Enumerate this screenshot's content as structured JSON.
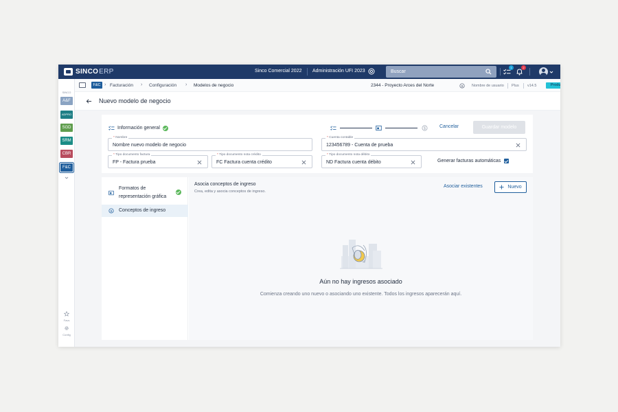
{
  "topbar": {
    "brand_bold": "SINCO",
    "brand_light": "ERP",
    "company": "Sinco Comercial 2022",
    "admin": "Administración UFI 2023",
    "search_placeholder": "Buscar",
    "tasks_badge": "1",
    "notifications_badge": "2"
  },
  "rail": {
    "title": "SINCO",
    "modules": [
      {
        "label": "A&F",
        "color": "#8aa3c2"
      },
      {
        "label": "ADPRO",
        "color": "#1f7f86"
      },
      {
        "label": "SGD",
        "color": "#5f9d4d"
      },
      {
        "label": "SRM",
        "color": "#1b8c86"
      },
      {
        "label": "CBR",
        "color": "#b84c5e"
      },
      {
        "label": "F&C",
        "color": "#1f5e9c"
      }
    ],
    "favorites_label": "Favs",
    "config_label": "Config"
  },
  "breadcrumb": {
    "module_chip": "F&C",
    "items": [
      "Facturación",
      "Configuración",
      "Modelos de negocio"
    ],
    "project": "2344 - Proyecto Arces del Norte",
    "username": "Nombre de usuario",
    "plan": "Plus",
    "version": "v14.5",
    "environment": "Producción"
  },
  "page": {
    "title": "Nuevo modelo de negocio"
  },
  "general_info": {
    "section_label": "Información general",
    "cancel_label": "Cancelar",
    "save_label": "Guardar modelo",
    "fields": {
      "name": {
        "label": "Nombre",
        "value": "Nombre nuevo modelo de negocio"
      },
      "account": {
        "label": "Cuenta contable",
        "value": "123456789 - Cuenta de prueba"
      },
      "invoice_doc": {
        "label": "Tipo documento factura",
        "value": "FP - Factura prueba"
      },
      "credit_doc": {
        "label": "Tipo documento nota crédito",
        "value": "FC Factura cuenta crédito"
      },
      "debit_doc": {
        "label": "Tipo documento nota débito",
        "value": "ND Factura cuenta débito"
      }
    },
    "auto_invoice_label": "Generar facturas automáticas",
    "auto_invoice_checked": true
  },
  "side_nav": {
    "items": [
      {
        "label": "Formatos de representación gráfica",
        "completed": true
      },
      {
        "label": "Conceptos de ingreso",
        "active": true
      }
    ]
  },
  "concepts": {
    "title": "Asocia conceptos de ingreso",
    "subtitle": "Crea, edita y asocia conceptos de ingreso.",
    "associate_label": "Asociar existentes",
    "new_label": "Nuevo",
    "empty_title": "Aún no hay ingresos asociado",
    "empty_description": "Comienza creando uno nuevo o asociando uno existente. Todos los ingresos aparecerán aquí."
  }
}
